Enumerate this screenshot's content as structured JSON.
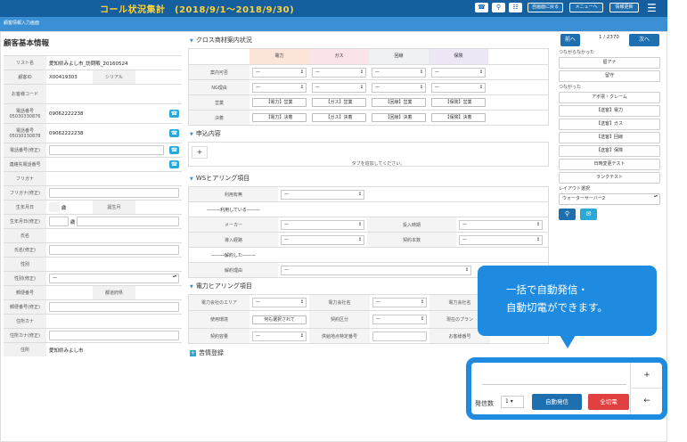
{
  "topbar": {
    "title": "コール状況集計　(2018/9/1〜2018/9/30)",
    "btn_return": "自画面に戻る",
    "btn_menu": "メニューへ",
    "btn_refresh": "情報更新"
  },
  "subbar": {
    "label": "顧客情報入力画面"
  },
  "left": {
    "heading": "顧客基本情報",
    "fields": [
      {
        "label": "リスト名",
        "value": "愛知県みよし市_訪問販_20160524"
      },
      {
        "label": "顧客ID",
        "value": "X00419303",
        "label2": "シリアル",
        "value2": ""
      },
      {
        "label": "お客様コード",
        "value": ""
      },
      {
        "label": "電話番号\n05030330876",
        "value": "09062222238"
      },
      {
        "label": "電話番号\n05030330878",
        "value": "09062222238"
      },
      {
        "label": "電話番号(修正)",
        "value": ""
      },
      {
        "label": "連絡先電話番号",
        "value": ""
      },
      {
        "label": "フリガナ",
        "value": ""
      },
      {
        "label": "フリガナ(修正)",
        "value": ""
      },
      {
        "label": "生年月日",
        "value": "歳",
        "label2": "誕生月",
        "value2": ""
      },
      {
        "label": "生年月日(修正)",
        "value": "歳"
      },
      {
        "label": "氏名",
        "value": ""
      },
      {
        "label": "氏名(修正)",
        "value": ""
      },
      {
        "label": "性別",
        "value": ""
      },
      {
        "label": "性別(修正)",
        "value": "—"
      },
      {
        "label": "郵便番号",
        "value": "",
        "label2": "都道府県",
        "value2": ""
      },
      {
        "label": "郵便番号(修正)",
        "value": ""
      },
      {
        "label": "住所カナ",
        "value": ""
      },
      {
        "label": "住所カナ(修正)",
        "value": ""
      },
      {
        "label": "住所",
        "value": "愛知県みよし市"
      }
    ]
  },
  "mid": {
    "sec1": "クロス商材案内状況",
    "cols": [
      "電力",
      "ガス",
      "回線",
      "保険"
    ],
    "rows": [
      {
        "label": "案内可否",
        "cells": [
          "—",
          "—",
          "—",
          "—"
        ]
      },
      {
        "label": "NG理由",
        "cells": [
          "—",
          "—",
          "—",
          "—"
        ]
      },
      {
        "label": "営業",
        "cells": [
          "【電力】営業",
          "【ガス】営業",
          "【回線】営業",
          "【保険】営業"
        ]
      },
      {
        "label": "決着",
        "cells": [
          "【電力】決着",
          "【ガス】決着",
          "【回線】決着",
          "【保険】決着"
        ]
      }
    ],
    "sec2": "申込内容",
    "tab_msg": "タブを追加してください。",
    "sec3": "WSヒアリング項目",
    "ws": {
      "use": "利用有無",
      "use_val": "—",
      "using": "———利用している———",
      "maker": "メーカー",
      "maker_val": "—",
      "install": "投入時期",
      "install_val": "—",
      "route": "導入経路",
      "route_val": "—",
      "contract": "契約本数",
      "contract_val": "—",
      "cancelled": "———解約した———",
      "reason": "解約理由",
      "reason_val": "—"
    },
    "sec4": "電力ヒアリング項目",
    "power": {
      "area": "電力会社のエリア",
      "area_val": "—",
      "company": "電力会社名",
      "company_val": "—",
      "company2": "電力会社名",
      "usage": "使用環境",
      "usage_val": "何も選択されて",
      "contract": "契約区分",
      "contract_val": "—",
      "plan": "現在のプラン",
      "capacity": "契約容量",
      "capacity_val": "—",
      "supply": "供給地点特定番号",
      "customer": "お客様番号"
    },
    "sec5": "苦情登録"
  },
  "right": {
    "prev": "前へ",
    "count": "1 / 2370",
    "next": "次へ",
    "not_connected": "つながらなかった",
    "nc_buttons": [
      "留アナ",
      "留守"
    ],
    "connected": "つながった",
    "c_buttons": [
      "アポ票・クレーム",
      "【送客】電力",
      "【送客】ガス",
      "【送客】回線",
      "【送客】保険",
      "日時変更テスト",
      "ランクテスト"
    ],
    "layout_label": "レイアウト選択",
    "layout_val": "ウォーターサーバー2"
  },
  "bubble": {
    "line1": "一括で自動発信・",
    "line2": "自動切電ができます。"
  },
  "popup": {
    "label": "発信数",
    "count": "1",
    "auto_call": "自動発信",
    "hangup": "全切電",
    "plus": "+",
    "back": "←"
  },
  "colors": {
    "topbar": "#155f9e",
    "accent": "#1e8be0",
    "danger": "#e04040",
    "title": "#ffd23a"
  }
}
